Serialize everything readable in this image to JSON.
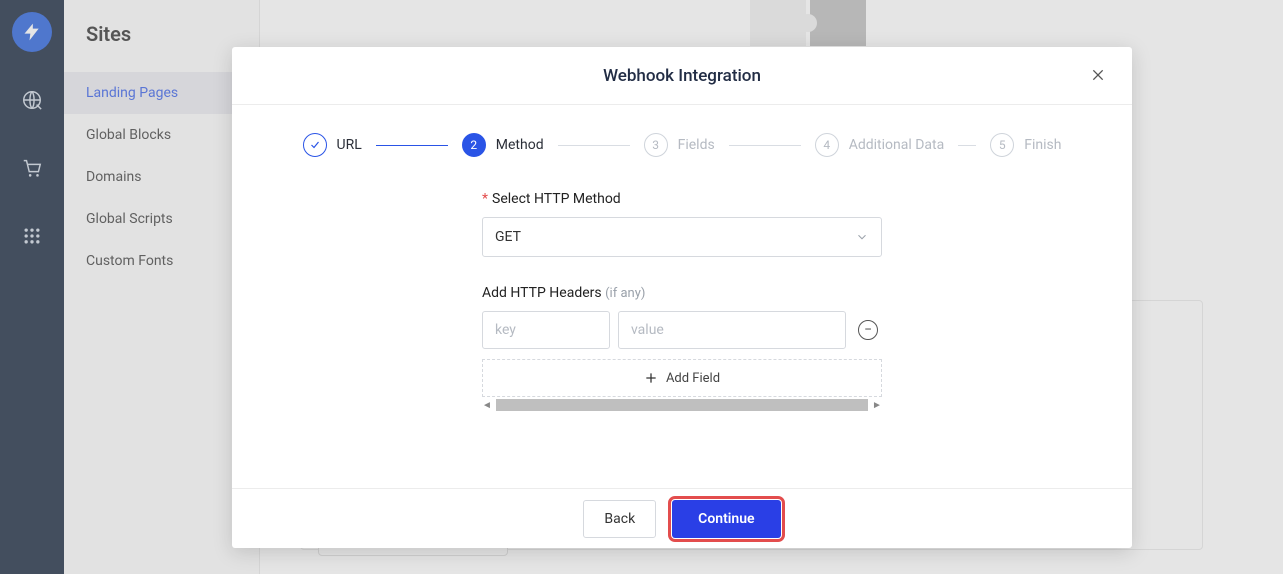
{
  "sidebar": {
    "title": "Sites",
    "items": [
      {
        "label": "Landing Pages",
        "active": true
      },
      {
        "label": "Global Blocks"
      },
      {
        "label": "Domains"
      },
      {
        "label": "Global Scripts"
      },
      {
        "label": "Custom Fonts"
      }
    ]
  },
  "modal": {
    "title": "Webhook Integration",
    "steps": [
      {
        "num": "✓",
        "label": "URL",
        "state": "done"
      },
      {
        "num": "2",
        "label": "Method",
        "state": "active"
      },
      {
        "num": "3",
        "label": "Fields",
        "state": "pending"
      },
      {
        "num": "4",
        "label": "Additional Data",
        "state": "pending"
      },
      {
        "num": "5",
        "label": "Finish",
        "state": "pending"
      }
    ],
    "form": {
      "method_label": "Select HTTP Method",
      "method_required": "*",
      "method_value": "GET",
      "headers_label": "Add HTTP Headers ",
      "headers_hint": "(if any)",
      "key_placeholder": "key",
      "value_placeholder": "value",
      "add_field_label": "Add Field",
      "remove_glyph": "−"
    },
    "footer": {
      "back": "Back",
      "continue": "Continue"
    }
  }
}
